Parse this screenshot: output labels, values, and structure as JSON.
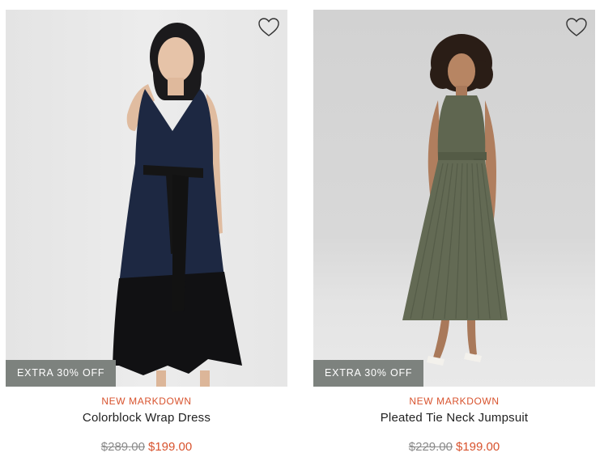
{
  "products": [
    {
      "badge": "EXTRA 30% OFF",
      "tag": "NEW MARKDOWN",
      "name": "Colorblock Wrap Dress",
      "original_price": "$289.00",
      "sale_price": "$199.00",
      "wishlist_icon": "heart-outline-icon"
    },
    {
      "badge": "EXTRA 30% OFF",
      "tag": "NEW MARKDOWN",
      "name": "Pleated Tie Neck Jumpsuit",
      "original_price": "$229.00",
      "sale_price": "$199.00",
      "wishlist_icon": "heart-outline-icon"
    }
  ],
  "colors": {
    "accent": "#d8532e",
    "badge_bg": "#7d827e"
  }
}
